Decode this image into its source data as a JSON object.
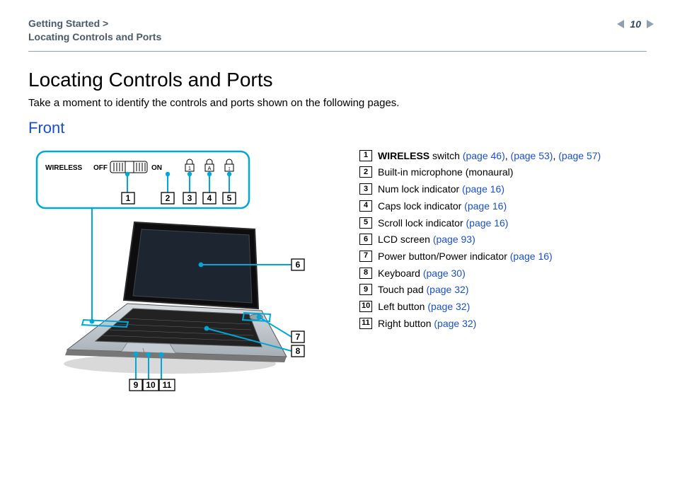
{
  "breadcrumb": {
    "line1": "Getting Started >",
    "line2": "Locating Controls and Ports"
  },
  "pageNumber": "10",
  "title": "Locating Controls and Ports",
  "intro": "Take a moment to identify the controls and ports shown on the following pages.",
  "sectionHeading": "Front",
  "figure": {
    "wirelessLabel": "WIRELESS",
    "offLabel": "OFF",
    "onLabel": "ON",
    "lockGlyphs": [
      "1",
      "A",
      "↕"
    ],
    "callouts": [
      "1",
      "2",
      "3",
      "4",
      "5",
      "6",
      "7",
      "8",
      "9",
      "10",
      "11"
    ]
  },
  "legend": [
    {
      "num": "1",
      "bold": "WIRELESS",
      "text": " switch ",
      "links": [
        "(page 46)",
        "(page 53)",
        "(page 57)"
      ],
      "sep": ", "
    },
    {
      "num": "2",
      "text": "Built-in microphone (monaural)",
      "links": []
    },
    {
      "num": "3",
      "text": "Num lock indicator ",
      "links": [
        "(page 16)"
      ]
    },
    {
      "num": "4",
      "text": "Caps lock indicator ",
      "links": [
        "(page 16)"
      ]
    },
    {
      "num": "5",
      "text": "Scroll lock indicator ",
      "links": [
        "(page 16)"
      ]
    },
    {
      "num": "6",
      "text": "LCD screen ",
      "links": [
        "(page 93)"
      ]
    },
    {
      "num": "7",
      "text": "Power button/Power indicator ",
      "links": [
        "(page 16)"
      ]
    },
    {
      "num": "8",
      "text": "Keyboard ",
      "links": [
        "(page 30)"
      ]
    },
    {
      "num": "9",
      "text": "Touch pad ",
      "links": [
        "(page 32)"
      ]
    },
    {
      "num": "10",
      "text": "Left button ",
      "links": [
        "(page 32)"
      ]
    },
    {
      "num": "11",
      "text": "Right button ",
      "links": [
        "(page 32)"
      ]
    }
  ]
}
